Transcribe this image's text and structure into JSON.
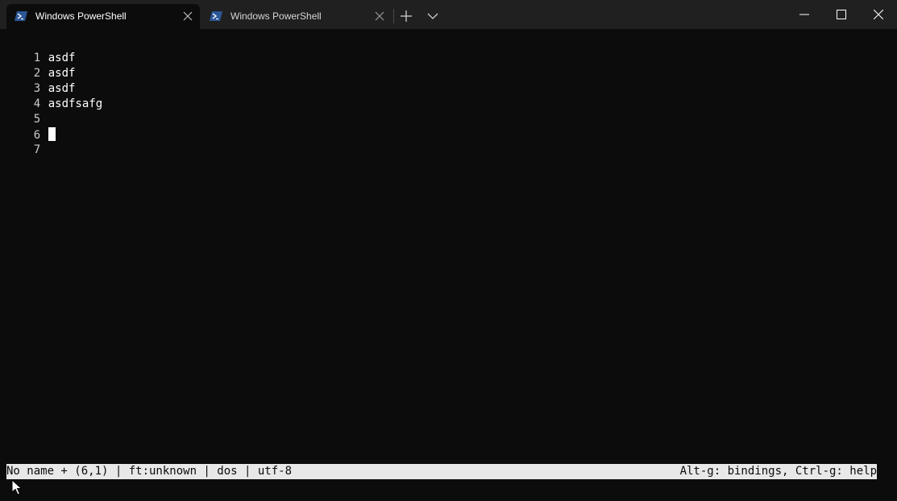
{
  "tabs": [
    {
      "title": "Windows PowerShell",
      "active": true,
      "icon": "powershell-icon"
    },
    {
      "title": "Windows PowerShell",
      "active": false,
      "icon": "powershell-icon"
    }
  ],
  "toolbar": {
    "new_tab_icon": "plus-icon",
    "dropdown_icon": "chevron-down-icon"
  },
  "window_controls": [
    "minimize-icon",
    "maximize-icon",
    "close-icon"
  ],
  "editor": {
    "lines": [
      {
        "number": "1",
        "text": "asdf"
      },
      {
        "number": "2",
        "text": "asdf"
      },
      {
        "number": "3",
        "text": "asdf"
      },
      {
        "number": "4",
        "text": "asdfsafg"
      },
      {
        "number": "5",
        "text": ""
      },
      {
        "number": "6",
        "text": ""
      },
      {
        "number": "7",
        "text": ""
      }
    ],
    "cursor_line": 6
  },
  "status": {
    "left": "No name + (6,1) | ft:unknown | dos | utf-8",
    "right": "Alt-g: bindings, Ctrl-g: help"
  },
  "colors": {
    "titlebar_bg": "#202020",
    "terminal_bg": "#0c0c0c",
    "text": "#cccccc",
    "status_bg": "#e8e8e8",
    "powershell_blue": "#2b5797"
  }
}
